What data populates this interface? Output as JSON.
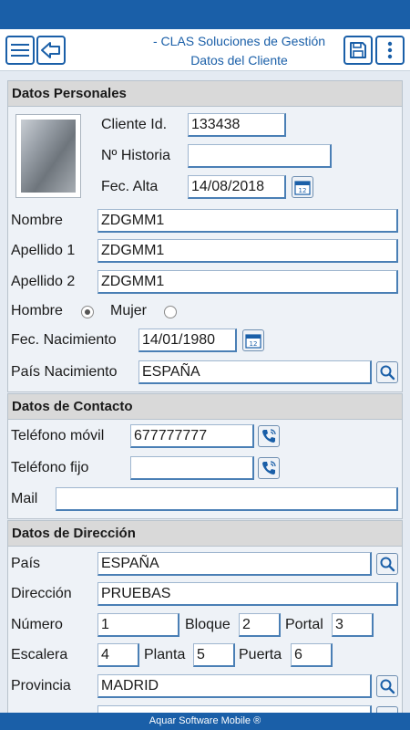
{
  "app": {
    "title": "- CLAS Soluciones de Gestión",
    "subtitle": "Datos del Cliente",
    "footer": "Aquar Software Mobile ®"
  },
  "colors": {
    "primary": "#1a5fa8",
    "background": "#e4eaf2",
    "section_header": "#d9d9d9"
  },
  "icons": {
    "menu": "hamburger-menu-icon",
    "back": "back-arrow-icon",
    "save": "save-disk-icon",
    "more": "more-vertical-icon",
    "calendar": "calendar-icon",
    "search": "search-icon",
    "phone": "phone-call-icon"
  },
  "personal": {
    "header": "Datos Personales",
    "client_id_label": "Cliente Id.",
    "client_id": "133438",
    "history_label": "Nº Historia",
    "history": "",
    "reg_date_label": "Fec. Alta",
    "reg_date": "14/08/2018",
    "name_label": "Nombre",
    "name": "ZDGMM1",
    "surname1_label": "Apellido 1",
    "surname1": "ZDGMM1",
    "surname2_label": "Apellido 2",
    "surname2": "ZDGMM1",
    "male_label": "Hombre",
    "female_label": "Mujer",
    "gender_selected": "Hombre",
    "birth_date_label": "Fec. Nacimiento",
    "birth_date": "14/01/1980",
    "birth_country_label": "País Nacimiento",
    "birth_country": "ESPAÑA"
  },
  "contact": {
    "header": "Datos de Contacto",
    "mobile_label": "Teléfono móvil",
    "mobile": "677777777",
    "landline_label": "Teléfono fijo",
    "landline": "",
    "mail_label": "Mail",
    "mail": ""
  },
  "address": {
    "header": "Datos de Dirección",
    "country_label": "País",
    "country": "ESPAÑA",
    "street_label": "Dirección",
    "street": "PRUEBAS",
    "number_label": "Número",
    "number": "1",
    "block_label": "Bloque",
    "block": "2",
    "portal_label": "Portal",
    "portal": "3",
    "stair_label": "Escalera",
    "stair": "4",
    "floor_label": "Planta",
    "floor": "5",
    "door_label": "Puerta",
    "door": "6",
    "province_label": "Provincia",
    "province": "MADRID"
  }
}
